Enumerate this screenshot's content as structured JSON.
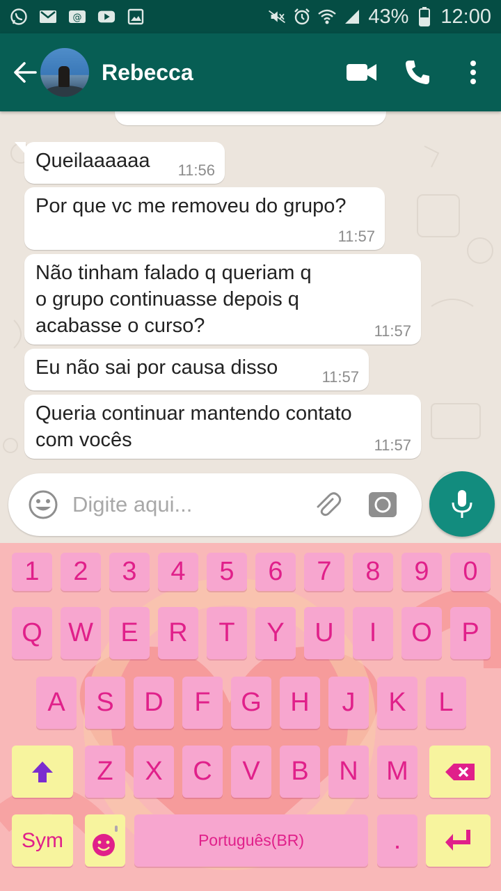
{
  "status_bar": {
    "left_icons": [
      "whatsapp-icon",
      "gmail-icon",
      "voicemail-icon",
      "youtube-icon",
      "gallery-icon"
    ],
    "right_icons": [
      "mute-icon",
      "alarm-icon",
      "wifi-icon",
      "signal-icon",
      "battery-icon"
    ],
    "battery": "43%",
    "time": "12:00"
  },
  "header": {
    "contact_name": "Rebecca",
    "actions": [
      "video-call-icon",
      "phone-call-icon",
      "more-options-icon"
    ]
  },
  "messages": [
    {
      "text": "Queilaaaaaa",
      "time": "11:56"
    },
    {
      "text": "Por que vc me removeu do grupo?",
      "time": "11:57"
    },
    {
      "text": "Não tinham falado q queriam q\no grupo continuasse depois q\nacabasse o curso?",
      "time": "11:57"
    },
    {
      "text": "Eu não sai por causa disso",
      "time": "11:57"
    },
    {
      "text": "Queria continuar mantendo contato\ncom vocês",
      "time": "11:57"
    }
  ],
  "composer": {
    "placeholder": "Digite aqui..."
  },
  "keyboard": {
    "row_numbers": [
      "1",
      "2",
      "3",
      "4",
      "5",
      "6",
      "7",
      "8",
      "9",
      "0"
    ],
    "row1": [
      "Q",
      "W",
      "E",
      "R",
      "T",
      "Y",
      "U",
      "I",
      "O",
      "P"
    ],
    "row2": [
      "A",
      "S",
      "D",
      "F",
      "G",
      "H",
      "J",
      "K",
      "L"
    ],
    "row3": [
      "Z",
      "X",
      "C",
      "V",
      "B",
      "N",
      "M"
    ],
    "sym_label": "Sym",
    "space_label": "Português(BR)",
    "period_label": "."
  },
  "colors": {
    "header": "#075e54",
    "status_bar": "#054d44",
    "mic": "#128c7e",
    "key_pink": "#f7a6cf",
    "key_yellow": "#f7f49e",
    "key_text": "#e0208a"
  }
}
